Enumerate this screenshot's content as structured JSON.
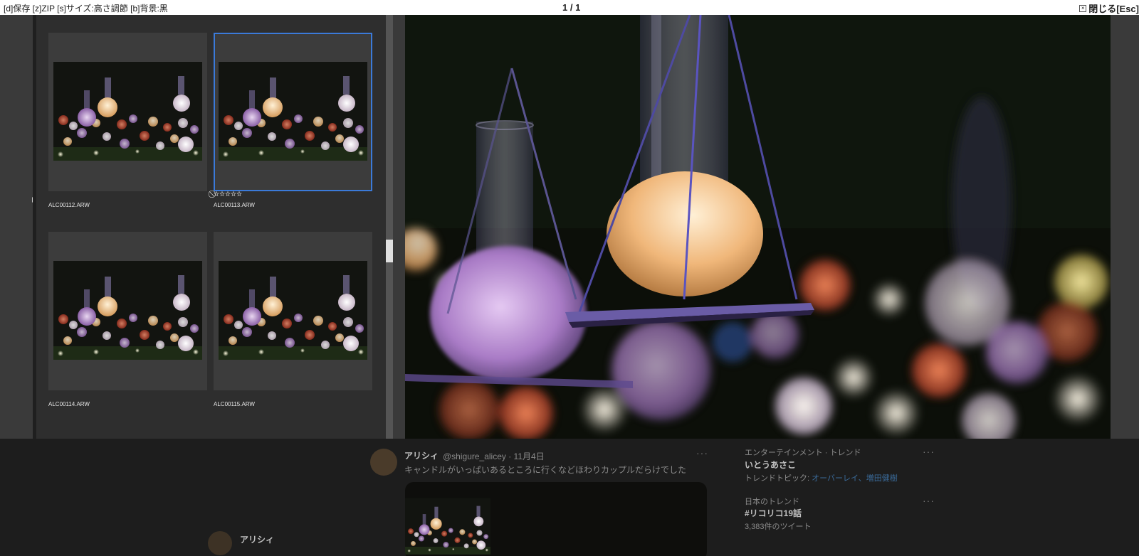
{
  "toolbar": {
    "hint": "[d]保存 [z]ZIP [s]サイズ:高さ調節 [b]背景:黒",
    "counter": "1 / 1",
    "close_label": "閉じる[Esc]"
  },
  "thumbnails": [
    {
      "filename": "ALC00112.ARW",
      "selected": false,
      "rating": null
    },
    {
      "filename": "ALC00113.ARW",
      "selected": true,
      "rating": "☆☆☆☆☆",
      "reject_icon": "⃠"
    },
    {
      "filename": "ALC00114.ARW",
      "selected": false,
      "rating": null
    },
    {
      "filename": "ALC00115.ARW",
      "selected": false,
      "rating": null
    }
  ],
  "background_page": {
    "tweet": {
      "author": "アリシィ",
      "handle_date": "@shigure_alicey · 11月4日",
      "text": "キャンドルがいっぱいあるところに行くなどほわりカップルだらけでした",
      "more": "···"
    },
    "second_author": "アリシィ",
    "trends": [
      {
        "category": "エンターテインメント · トレンド",
        "title": "いとうあさこ",
        "topic_prefix": "トレンドトピック: ",
        "topic_links": "オーバーレイ、増田健樹"
      },
      {
        "category": "日本のトレンド",
        "title": "#リコリコ19話",
        "count": "3,383件のツイート"
      }
    ]
  },
  "colors": {
    "selection": "#3b7ad9",
    "topbar_bg": "#ffffff",
    "panel_bg": "#2e2e2e"
  }
}
